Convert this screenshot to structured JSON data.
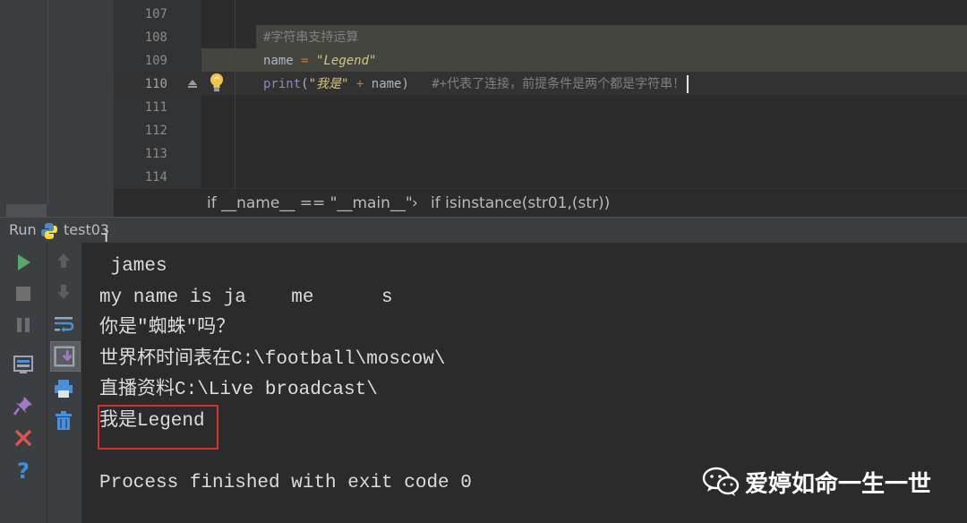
{
  "editor": {
    "line_numbers": [
      "107",
      "108",
      "109",
      "110",
      "111",
      "112",
      "113",
      "114"
    ],
    "code": {
      "comment_line": "#字符串支持运算",
      "assign_var": "name",
      "assign_op": "=",
      "assign_str": "\"Legend\"",
      "print_fn": "print",
      "print_open": "(",
      "print_str": "\"我是\"",
      "print_plus": "+",
      "print_arg": "name)",
      "trailing_comment": "#+代表了连接，前提条件是两个都是字符串！"
    },
    "icons": {
      "bulb": "lightbulb-icon",
      "fold": "fold-marker-icon"
    }
  },
  "breadcrumb": {
    "item1": "if __name__ == \"__main__\"",
    "separator": "›",
    "item2": "if isinstance(str01,(str))"
  },
  "run_window": {
    "label": "Run",
    "tab": "test03",
    "tab_icon": "python-icon",
    "toolbar_left": [
      "run-icon",
      "stop-icon",
      "pause-icon",
      "layout-icon",
      "pin-icon",
      "close-icon",
      "help-icon"
    ],
    "toolbar_right": [
      "up-arrow-icon",
      "down-arrow-icon",
      "soft-wrap-icon",
      "scroll-to-end-icon",
      "print-icon",
      "trash-icon"
    ]
  },
  "console": {
    "lines": [
      " james",
      "my name is ja    me      s",
      "你是\"蜘蛛\"吗？",
      "世界杯时间表在C:\\football\\moscow\\",
      "直播资料C:\\Live broadcast\\",
      "我是Legend",
      "Process finished with exit code 0"
    ],
    "clipped_top": "j"
  },
  "watermark": {
    "text": "爱婷如命一生一世",
    "icon": "wechat-icon"
  },
  "colors": {
    "background": "#2b2b2b",
    "panel": "#3c3f41",
    "comment": "#808080",
    "string": "#d7c37d",
    "builtin": "#8888c6",
    "highlight_box": "#d6322b"
  }
}
